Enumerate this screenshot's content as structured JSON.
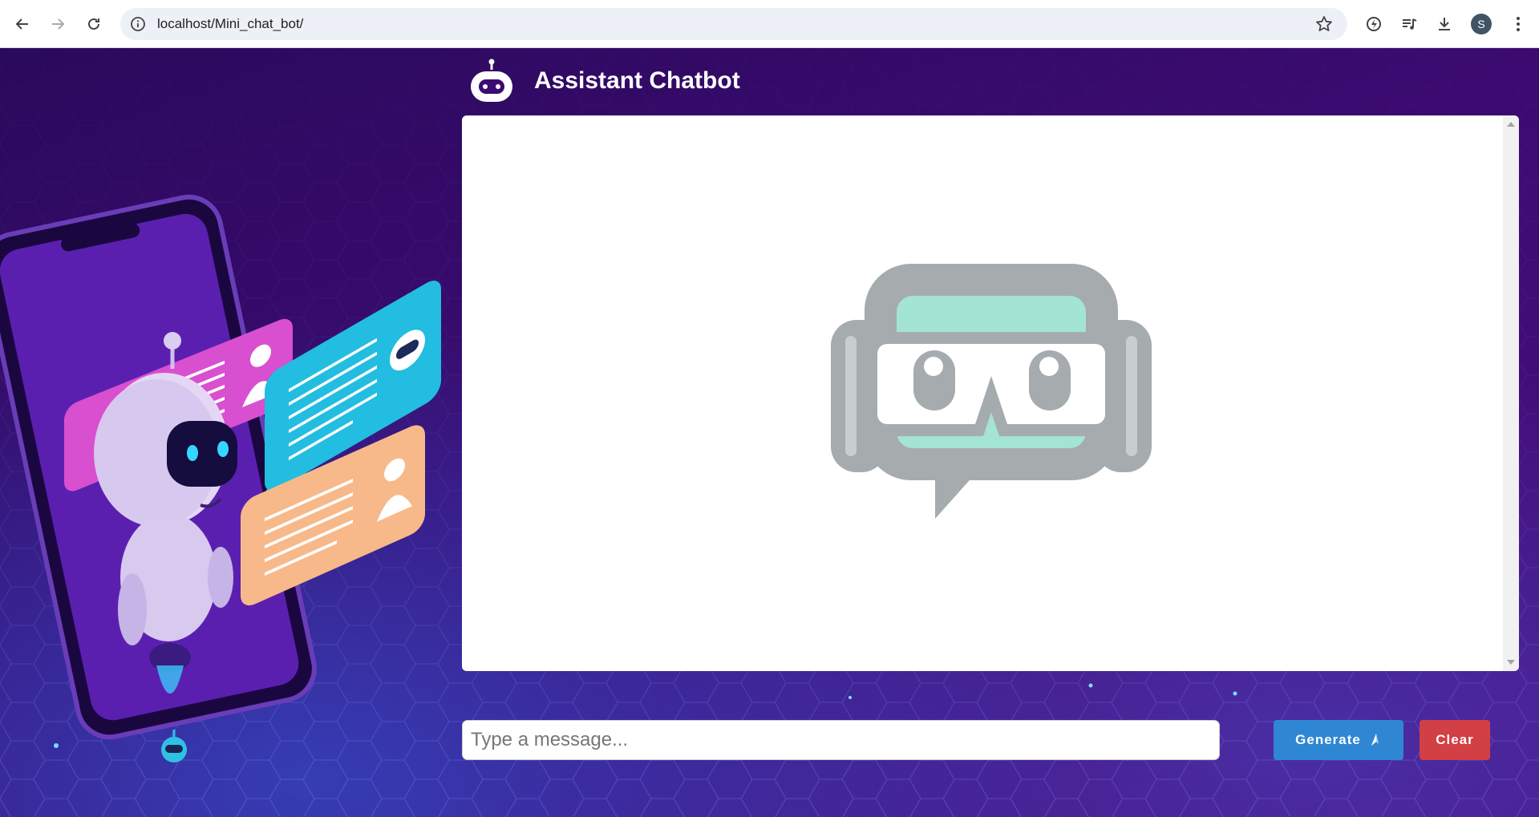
{
  "browser": {
    "url": "localhost/Mini_chat_bot/",
    "profile_initial": "S"
  },
  "header": {
    "title": "Assistant Chatbot",
    "logo_icon": "robot-head-icon"
  },
  "chat": {
    "empty_state_icon": "chatbot-placeholder-icon",
    "messages": []
  },
  "composer": {
    "placeholder": "Type a message...",
    "value": "",
    "generate_label": "Generate",
    "generate_icon": "sparkle-icon",
    "clear_label": "Clear"
  },
  "colors": {
    "background": "#3a0b6e",
    "generate_button": "#2f87d4",
    "clear_button": "#d23f45",
    "placeholder_icon_gray": "#a6abae",
    "placeholder_icon_teal": "#a3e4d4"
  }
}
